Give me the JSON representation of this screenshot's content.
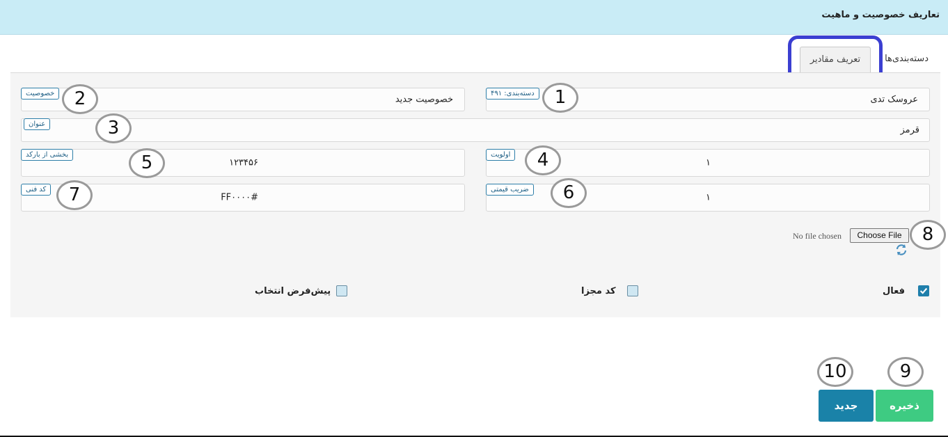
{
  "header": {
    "title": "تعاریف خصوصیت و ماهیت"
  },
  "tabs": {
    "categories": "دسته‌بندی‌ها",
    "values": "تعریف مقادیر"
  },
  "fields": {
    "category": {
      "tag": "دسته‌بندی: ۴۹۱",
      "value": "عروسک تدی"
    },
    "property": {
      "tag": "خصوصیت",
      "value": "خصوصیت جدید"
    },
    "title": {
      "tag": "عنوان",
      "value": "قرمز"
    },
    "priority": {
      "tag": "اولویت",
      "value": "۱"
    },
    "barcode_part": {
      "tag": "بخشی از بارکد",
      "value": "۱۲۳۴۵۶"
    },
    "price_factor": {
      "tag": "ضریب قیمتی",
      "value": "۱"
    },
    "tech_code": {
      "tag": "کد فنی",
      "value": "#FF۰۰۰۰"
    }
  },
  "file": {
    "button": "Choose File",
    "status": "No file chosen"
  },
  "checkboxes": {
    "active": {
      "label": "فعال",
      "checked": true
    },
    "separate_code": {
      "label": "کد مجزا",
      "checked": false
    },
    "default_select": {
      "label": "پیش‌فرض انتخاب",
      "checked": false
    }
  },
  "buttons": {
    "save": "ذخیره",
    "new": "جدید"
  },
  "annotations": [
    "1",
    "2",
    "3",
    "4",
    "5",
    "6",
    "7",
    "8",
    "9",
    "10"
  ],
  "colors": {
    "header_bg": "#c9ecf6",
    "save": "#3ecb82",
    "new": "#1a82a8",
    "highlight": "#3b3fd1",
    "tag_border": "#2d7ea8"
  }
}
